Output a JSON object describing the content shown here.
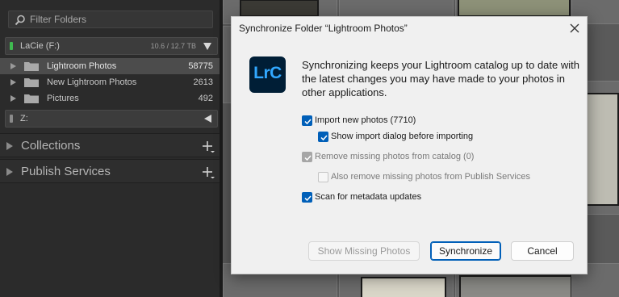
{
  "left_panel": {
    "filter": {
      "placeholder": "Filter Folders"
    },
    "volumes": [
      {
        "name": "LaCie  (F:)",
        "size": "10.6 / 12.7 TB",
        "indicator_color": "#3fb950"
      },
      {
        "name": "Z:",
        "size": "",
        "indicator_color": "#8a8a8a"
      }
    ],
    "folders": [
      {
        "name": "Lightroom Photos",
        "count": "58775",
        "selected": true
      },
      {
        "name": "New Lightroom Photos",
        "count": "2613",
        "selected": false
      },
      {
        "name": "Pictures",
        "count": "492",
        "selected": false
      }
    ],
    "sections": [
      {
        "label": "Collections"
      },
      {
        "label": "Publish Services"
      }
    ]
  },
  "dialog": {
    "title": "Synchronize Folder “Lightroom Photos”",
    "logo_text": "LrC",
    "description": "Synchronizing keeps your Lightroom catalog up to date with the latest changes you may have made to your photos in other applications.",
    "options": [
      {
        "label": "Import new photos (7710)",
        "state": "checked",
        "enabled": true
      },
      {
        "label": "Show import dialog before importing",
        "state": "checked",
        "enabled": true
      },
      {
        "label": "Remove missing photos from catalog (0)",
        "state": "checked",
        "enabled": false
      },
      {
        "label": "Also remove missing photos from Publish Services",
        "state": "unchecked",
        "enabled": false
      },
      {
        "label": "Scan for metadata updates",
        "state": "checked",
        "enabled": true
      }
    ],
    "buttons": {
      "show_missing": "Show Missing Photos",
      "synchronize": "Synchronize",
      "cancel": "Cancel"
    }
  },
  "colors": {
    "accent": "#005fb8",
    "logo_bg": "#001e36",
    "logo_text": "#31a8ff"
  }
}
